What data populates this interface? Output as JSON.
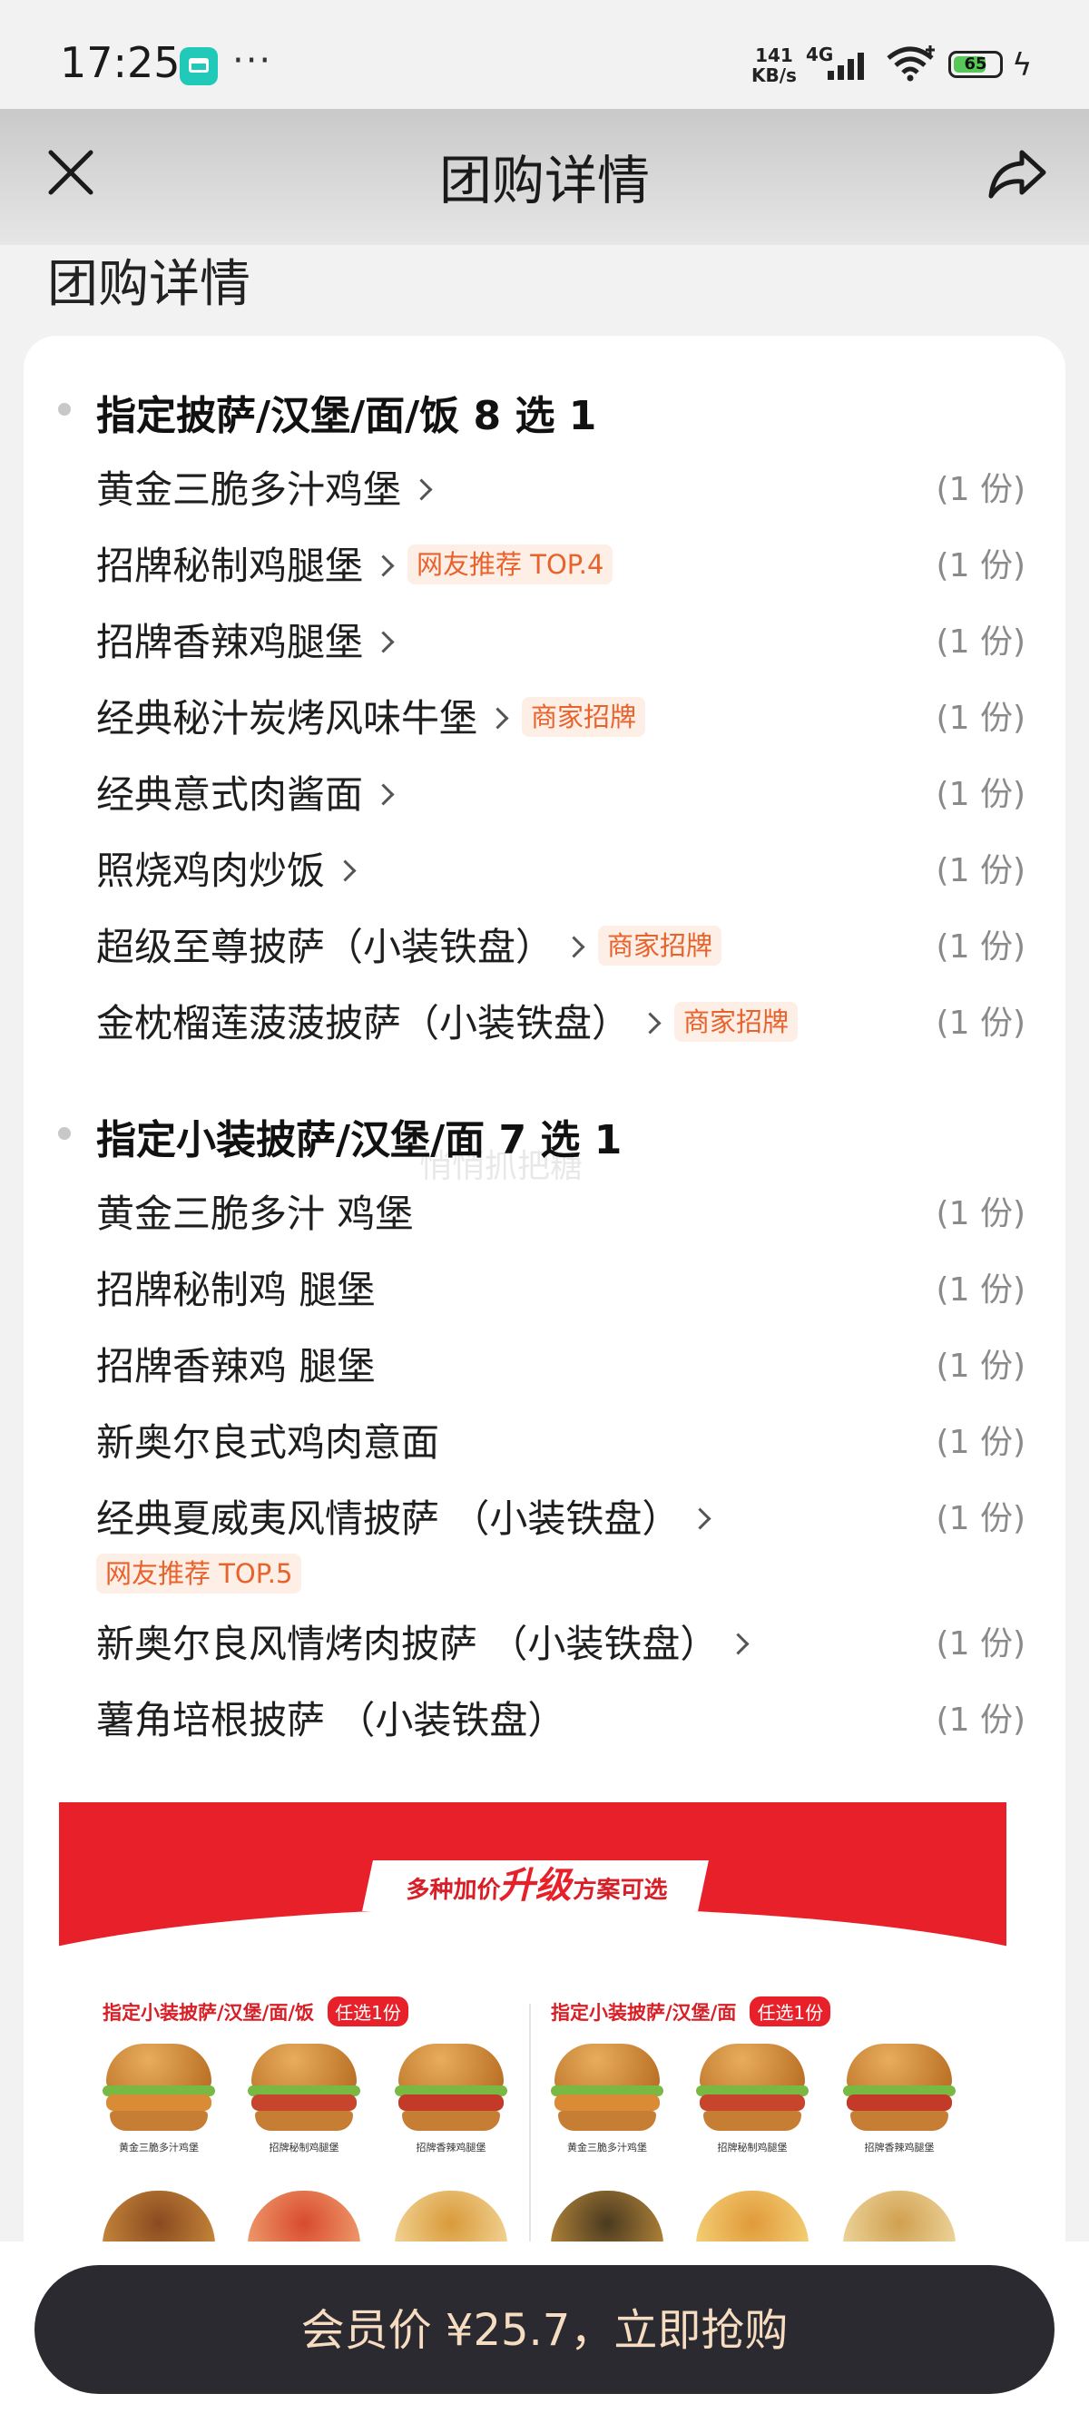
{
  "status_bar": {
    "time": "17:25",
    "more": "···",
    "net_speed_value": "141",
    "net_speed_unit": "KB/s",
    "network_type": "4G",
    "battery_level": "65",
    "icons": [
      "app-icon",
      "signal-icon",
      "wifi-icon",
      "battery-icon",
      "charging-icon"
    ]
  },
  "header": {
    "title": "团购详情",
    "close_icon": "close-icon",
    "share_icon": "share-icon"
  },
  "section_title": "团购详情",
  "groups": [
    {
      "title": "指定披萨/汉堡/面/饭 8 选 1",
      "items": [
        {
          "name": "黄金三脆多汁鸡堡",
          "qty": "(1 份)",
          "arrow": true,
          "tag": ""
        },
        {
          "name": "招牌秘制鸡腿堡",
          "qty": "(1 份)",
          "arrow": true,
          "tag": "网友推荐 TOP.4"
        },
        {
          "name": "招牌香辣鸡腿堡",
          "qty": "(1 份)",
          "arrow": true,
          "tag": ""
        },
        {
          "name": "经典秘汁炭烤风味牛堡",
          "qty": "(1 份)",
          "arrow": true,
          "tag": "商家招牌"
        },
        {
          "name": "经典意式肉酱面",
          "qty": "(1 份)",
          "arrow": true,
          "tag": ""
        },
        {
          "name": "照烧鸡肉炒饭",
          "qty": "(1 份)",
          "arrow": true,
          "tag": ""
        },
        {
          "name": "超级至尊披萨（小装铁盘）",
          "qty": "(1 份)",
          "arrow": true,
          "tag": "商家招牌"
        },
        {
          "name": "金枕榴莲菠菠披萨（小装铁盘）",
          "qty": "(1 份)",
          "arrow": true,
          "tag": "商家招牌"
        }
      ]
    },
    {
      "title": "指定小装披萨/汉堡/面 7 选 1",
      "items": [
        {
          "name": "黄金三脆多汁 鸡堡",
          "qty": "(1 份)",
          "arrow": false,
          "tag": ""
        },
        {
          "name": "招牌秘制鸡 腿堡",
          "qty": "(1 份)",
          "arrow": false,
          "tag": ""
        },
        {
          "name": "招牌香辣鸡 腿堡",
          "qty": "(1 份)",
          "arrow": false,
          "tag": ""
        },
        {
          "name": "新奥尔良式鸡肉意面",
          "qty": "(1 份)",
          "arrow": false,
          "tag": ""
        },
        {
          "name": "经典夏威夷风情披萨 （小装铁盘）",
          "qty": "(1 份)",
          "arrow": true,
          "tag": "网友推荐 TOP.5"
        },
        {
          "name": "新奥尔良风情烤肉披萨 （小装铁盘）",
          "qty": "(1 份)",
          "arrow": true,
          "tag": ""
        },
        {
          "name": "薯角培根披萨 （小装铁盘）",
          "qty": "(1 份)",
          "arrow": false,
          "tag": ""
        }
      ]
    }
  ],
  "watermark": "悄悄抓把糖",
  "promo": {
    "banner_prefix": "多种加价",
    "banner_highlight": "升级",
    "banner_suffix": "方案可选",
    "left_heading": "指定小装披萨/汉堡/面/饭",
    "left_badge": "任选1份",
    "right_heading": "指定小装披萨/汉堡/面",
    "right_badge": "任选1份",
    "left_captions": [
      "黄金三脆多汁鸡堡",
      "招牌秘制鸡腿堡",
      "招牌香辣鸡腿堡"
    ],
    "right_captions": [
      "黄金三脆多汁鸡堡",
      "招牌秘制鸡腿堡",
      "招牌香辣鸡腿堡"
    ]
  },
  "buy_button": {
    "label": "会员价 ¥25.7，立即抢购"
  },
  "colors": {
    "accent_tag_text": "#e8622c",
    "accent_tag_bg": "#fdeee6",
    "buy_button_bg": "#2b2a30",
    "buy_button_text": "#f6dcc0",
    "promo_red": "#e8202a"
  }
}
